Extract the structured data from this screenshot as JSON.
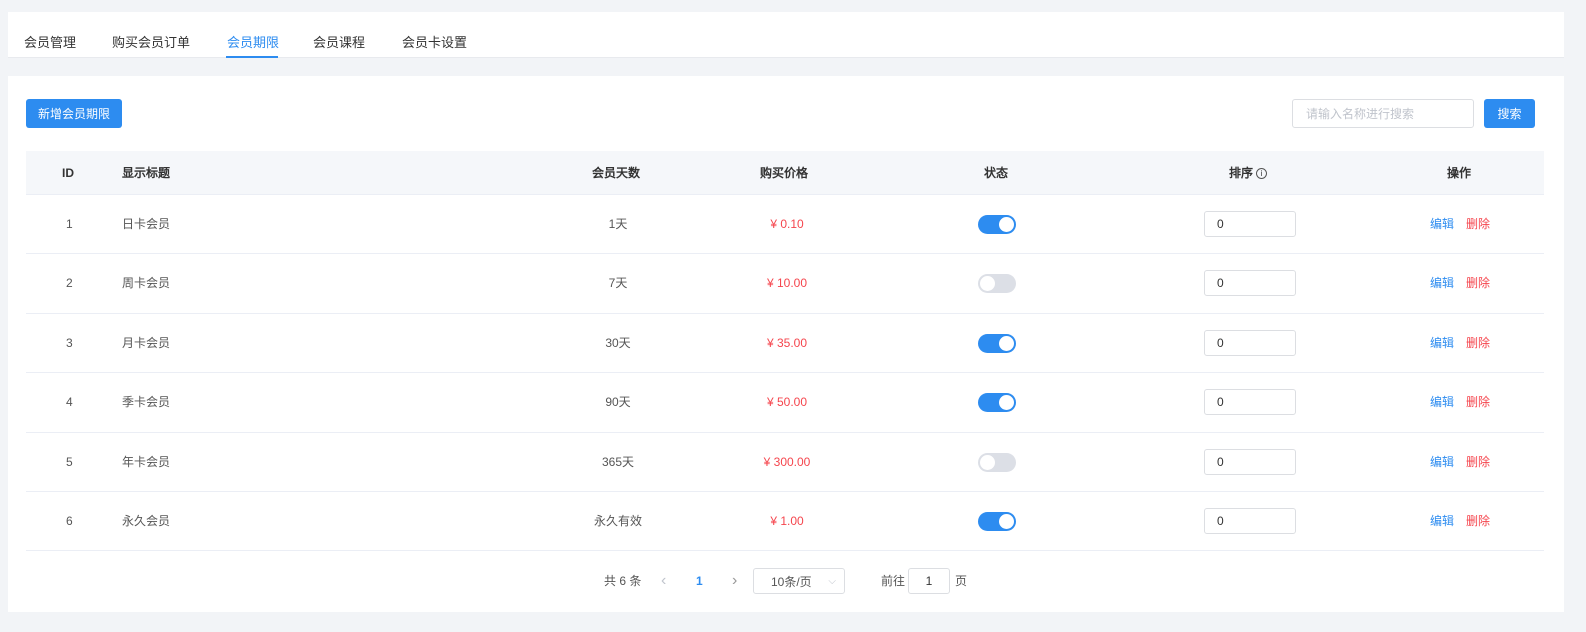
{
  "tabs": [
    {
      "label": "会员管理"
    },
    {
      "label": "购买会员订单"
    },
    {
      "label": "会员期限",
      "active": true
    },
    {
      "label": "会员课程"
    },
    {
      "label": "会员卡设置"
    }
  ],
  "toolbar": {
    "add_label": "新增会员期限",
    "search_placeholder": "请输入名称进行搜索",
    "search_value": "",
    "search_label": "搜索"
  },
  "table": {
    "headers": {
      "id": "ID",
      "title": "显示标题",
      "days": "会员天数",
      "price": "购买价格",
      "status": "状态",
      "sort": "排序",
      "actions": "操作"
    },
    "rows": [
      {
        "id": "1",
        "title": "日卡会员",
        "days": "1天",
        "price": "¥ 0.10",
        "status_on": true,
        "sort": "0"
      },
      {
        "id": "2",
        "title": "周卡会员",
        "days": "7天",
        "price": "¥ 10.00",
        "status_on": false,
        "sort": "0"
      },
      {
        "id": "3",
        "title": "月卡会员",
        "days": "30天",
        "price": "¥ 35.00",
        "status_on": true,
        "sort": "0"
      },
      {
        "id": "4",
        "title": "季卡会员",
        "days": "90天",
        "price": "¥ 50.00",
        "status_on": true,
        "sort": "0"
      },
      {
        "id": "5",
        "title": "年卡会员",
        "days": "365天",
        "price": "¥ 300.00",
        "status_on": false,
        "sort": "0"
      },
      {
        "id": "6",
        "title": "永久会员",
        "days": "永久有效",
        "price": "¥ 1.00",
        "status_on": true,
        "sort": "0"
      }
    ],
    "edit_label": "编辑",
    "delete_label": "删除"
  },
  "pagination": {
    "total_text": "共 6 条",
    "prev_icon": "‹",
    "current_page": "1",
    "next_icon": "›",
    "page_size": "10条/页",
    "goto_prefix": "前往",
    "goto_value": "1",
    "goto_suffix": "页"
  },
  "colors": {
    "primary": "#2d8cf0",
    "danger": "#f5454d"
  }
}
